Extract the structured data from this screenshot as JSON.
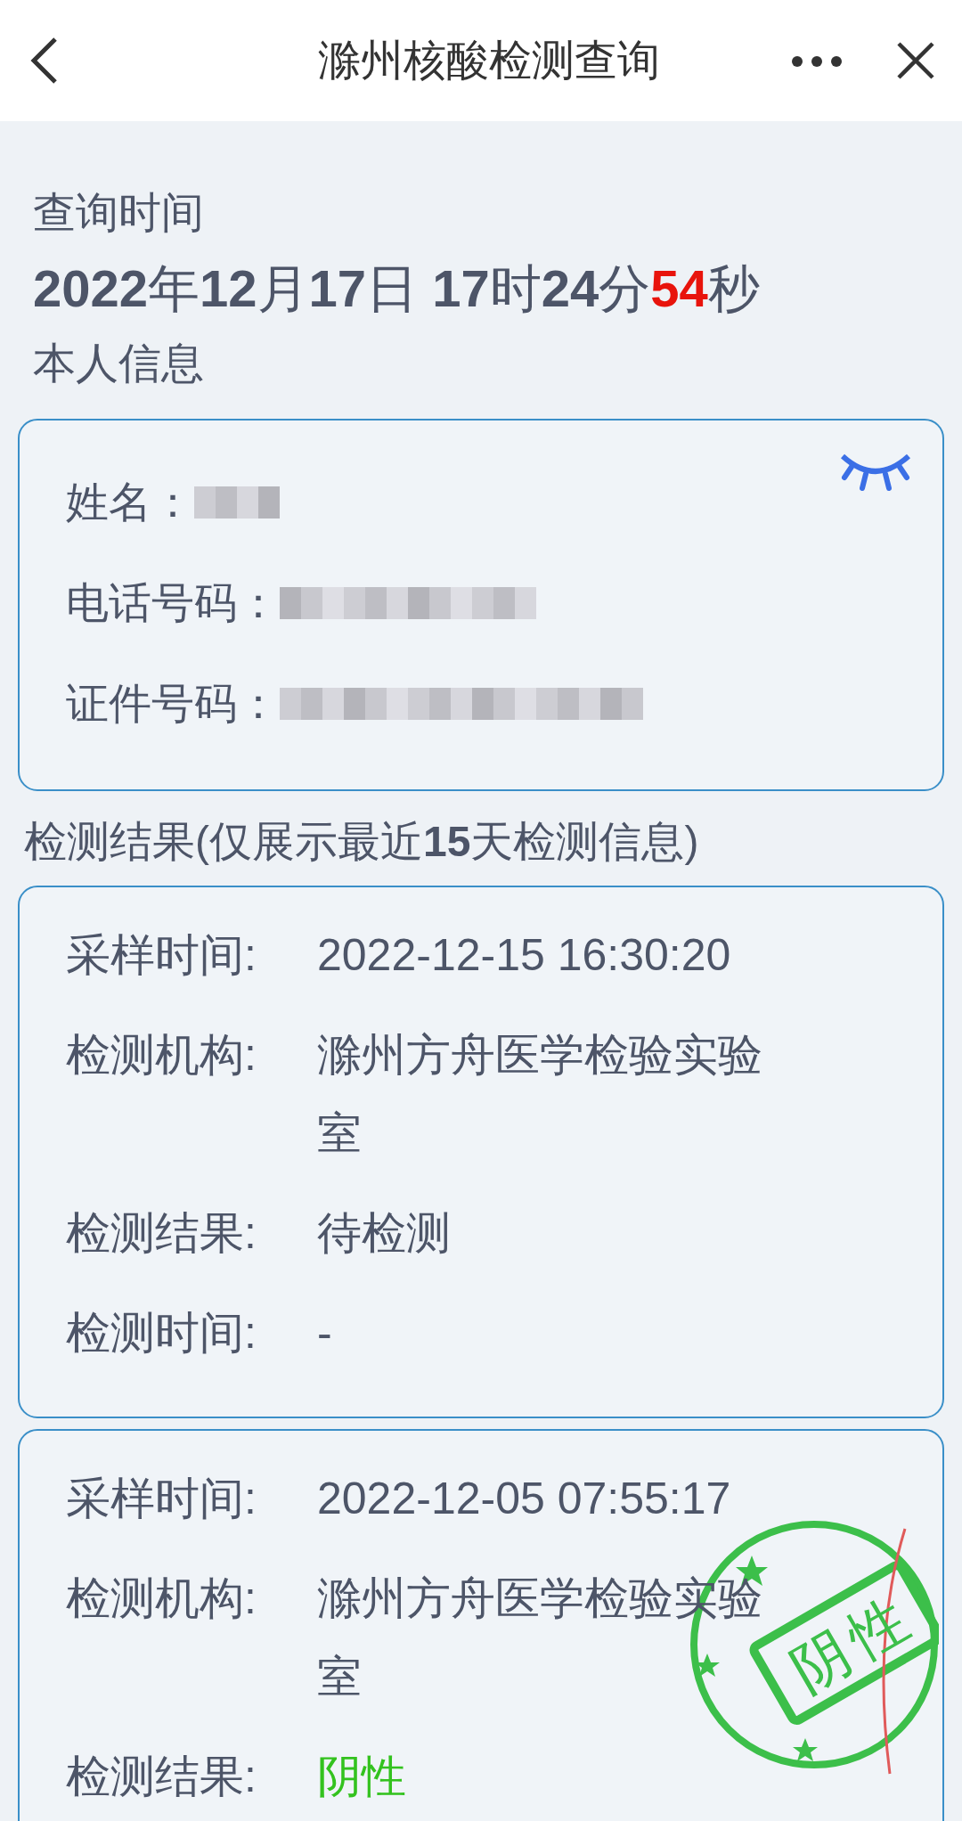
{
  "header": {
    "title": "滁州核酸检测查询"
  },
  "query": {
    "label": "查询时间",
    "time": "**2022**年**12**月**17**日 **17**时**24**分",
    "seconds": "54",
    "seconds_unit": "秒"
  },
  "personal": {
    "title": "本人信息",
    "fields": [
      {
        "label": "姓名：",
        "redacted": true
      },
      {
        "label": "电话号码：",
        "redacted": true
      },
      {
        "label": "证件号码：",
        "redacted": true
      }
    ]
  },
  "results_title": "检测结果(仅展示最近**15**天检测信息)",
  "results": [
    {
      "rows": [
        {
          "label": "采样时间:",
          "value": "2022-12-15 16:30:20"
        },
        {
          "label": "检测机构:",
          "value": "滁州方舟医学检验实验室"
        },
        {
          "label": "检测结果:",
          "value": "待检测"
        },
        {
          "label": "检测时间:",
          "value": "-"
        }
      ]
    },
    {
      "rows": [
        {
          "label": "采样时间:",
          "value": "2022-12-05 07:55:17"
        },
        {
          "label": "检测机构:",
          "value": "滁州方舟医学检验实验室"
        },
        {
          "label": "检测结果:",
          "value": "阴性",
          "color": "#33c21e"
        }
      ],
      "stamp": "阴性"
    }
  ]
}
